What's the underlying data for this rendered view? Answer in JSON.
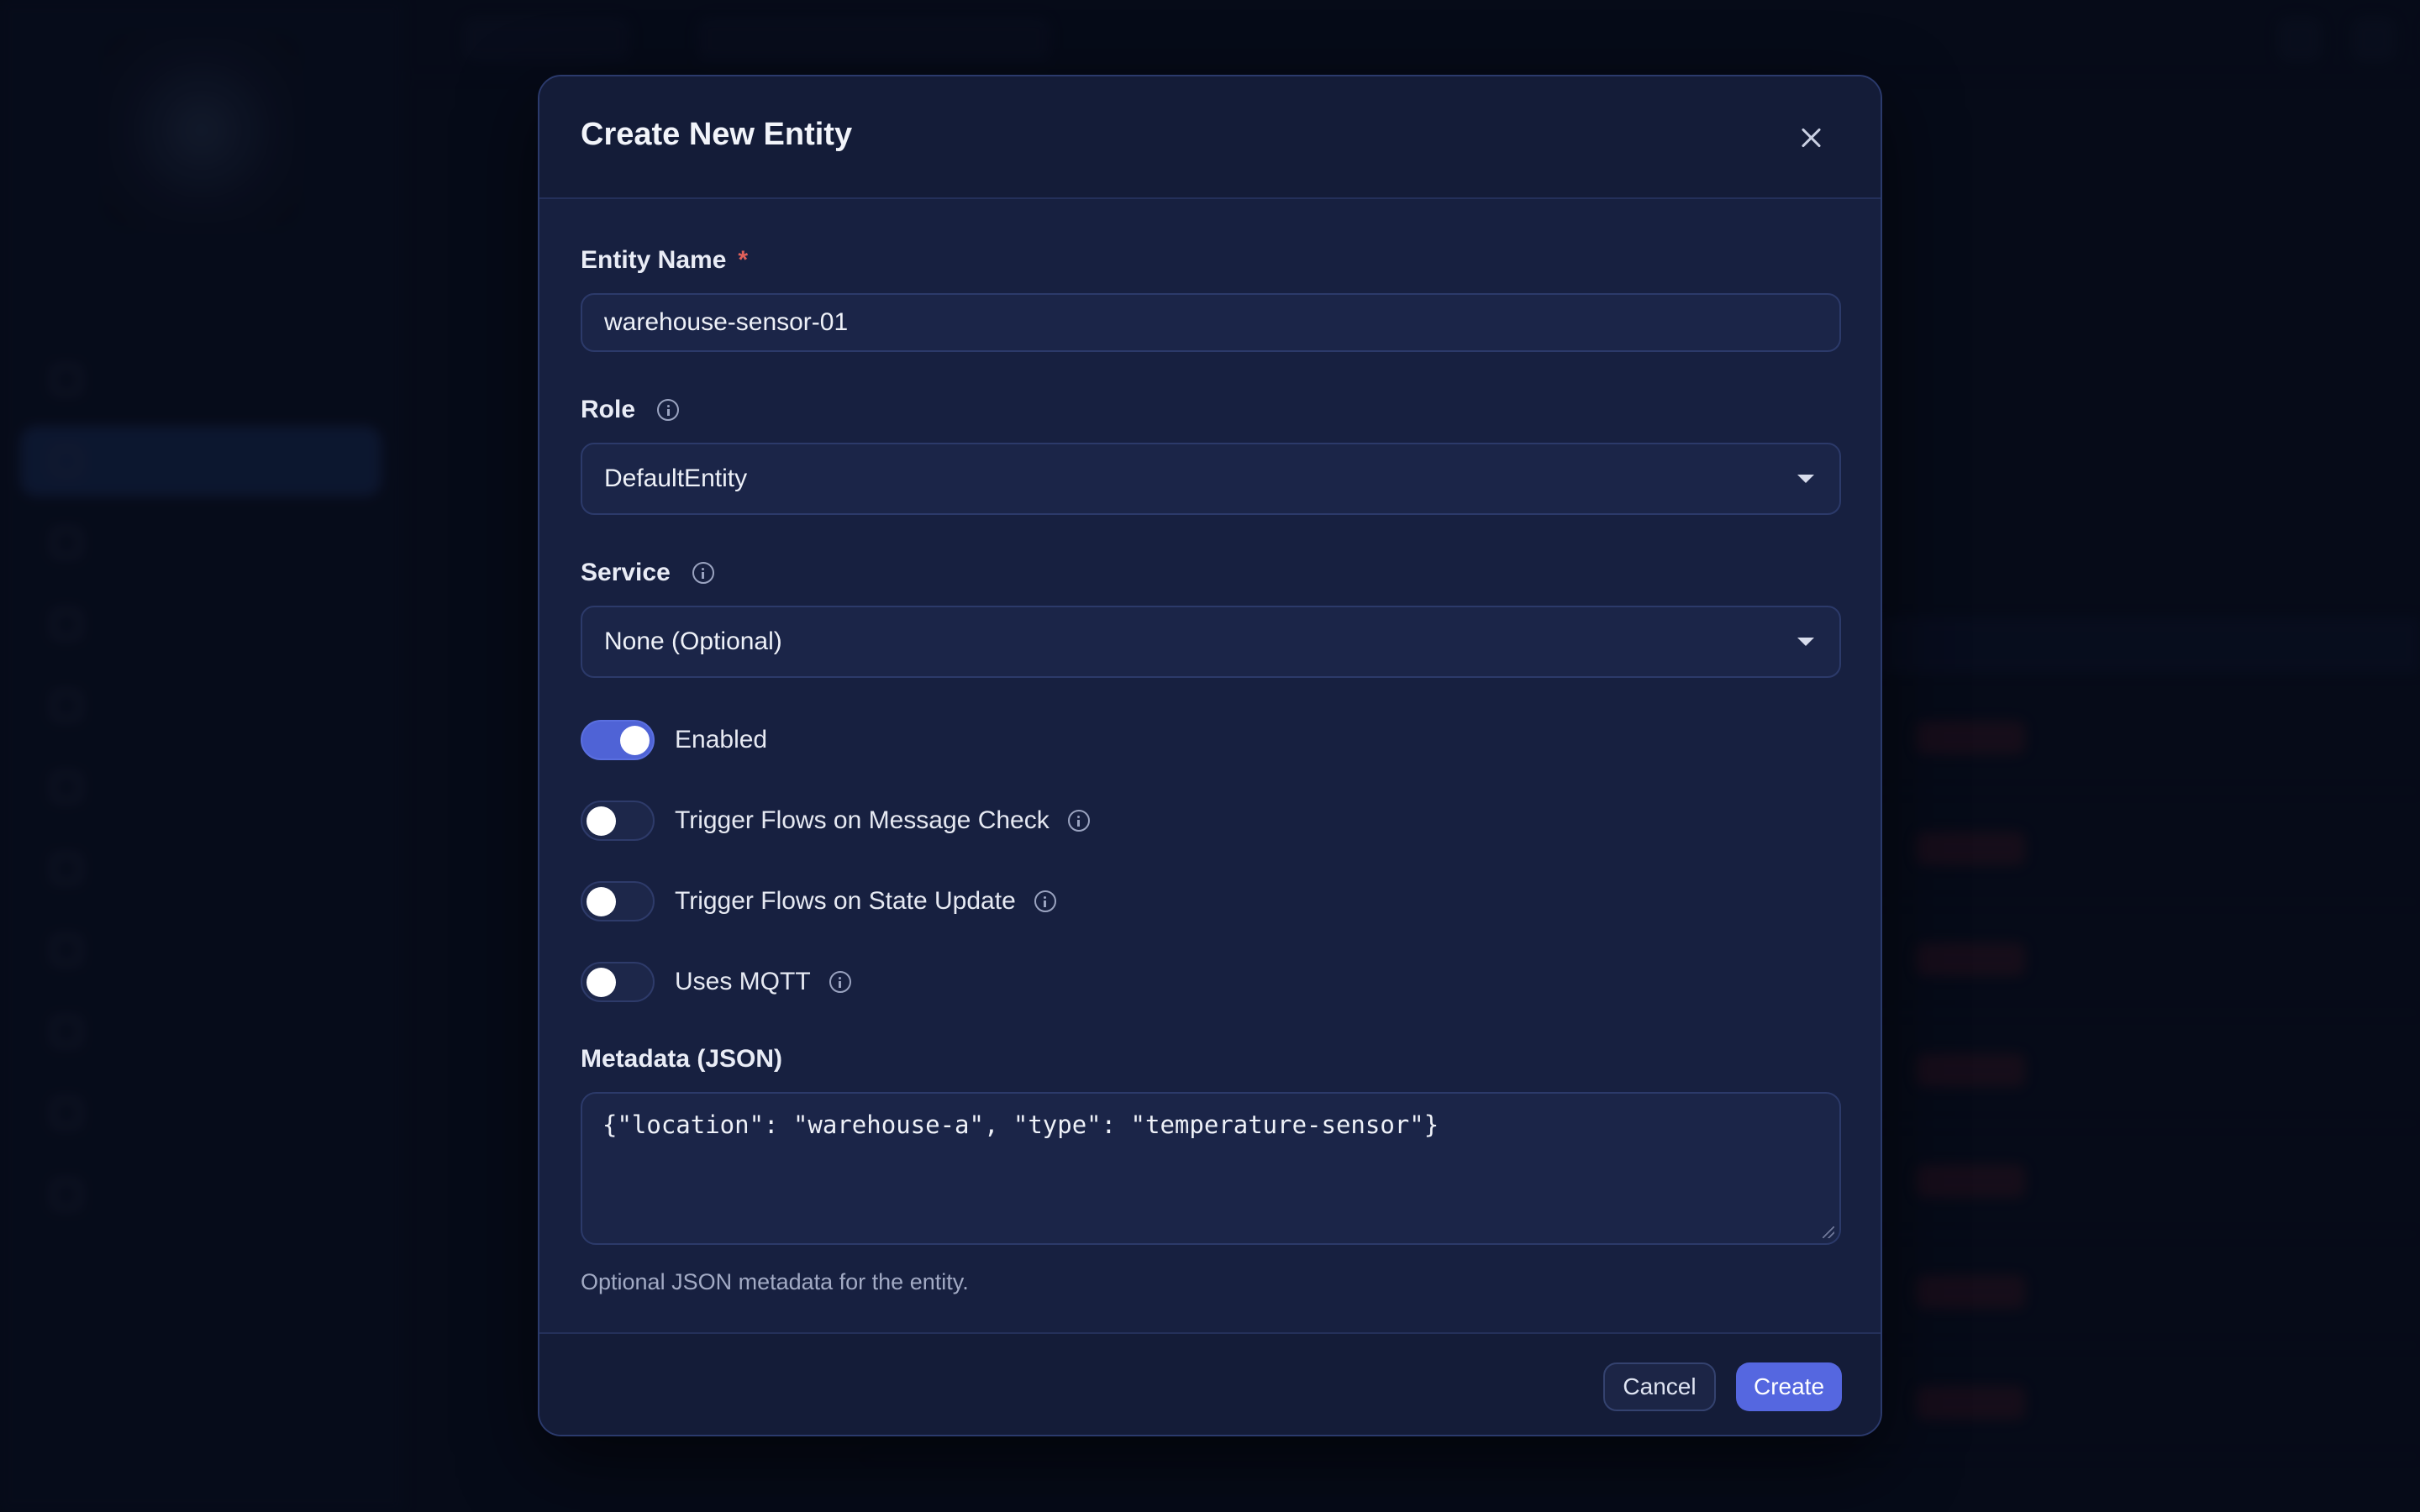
{
  "modal": {
    "title": "Create New Entity",
    "entity_name": {
      "label": "Entity Name",
      "required_mark": "*",
      "value": "warehouse-sensor-01"
    },
    "role": {
      "label": "Role",
      "selected": "DefaultEntity"
    },
    "service": {
      "label": "Service",
      "selected": "None (Optional)"
    },
    "toggles": [
      {
        "label": "Enabled",
        "on": true,
        "has_info": false
      },
      {
        "label": "Trigger Flows on Message Check",
        "on": false,
        "has_info": true
      },
      {
        "label": "Trigger Flows on State Update",
        "on": false,
        "has_info": true
      },
      {
        "label": "Uses MQTT",
        "on": false,
        "has_info": true
      }
    ],
    "metadata": {
      "label": "Metadata (JSON)",
      "value": "{\"location\": \"warehouse-a\", \"type\": \"temperature-sensor\"}",
      "helper": "Optional JSON metadata for the entity."
    },
    "cancel_label": "Cancel",
    "create_label": "Create"
  },
  "colors": {
    "accent": "#5567e0",
    "toggle_on": "#4f63d6",
    "required": "#e0605a",
    "modal_bg": "#172040"
  },
  "icons": [
    "close-icon",
    "info-icon",
    "chevron-down-icon"
  ]
}
